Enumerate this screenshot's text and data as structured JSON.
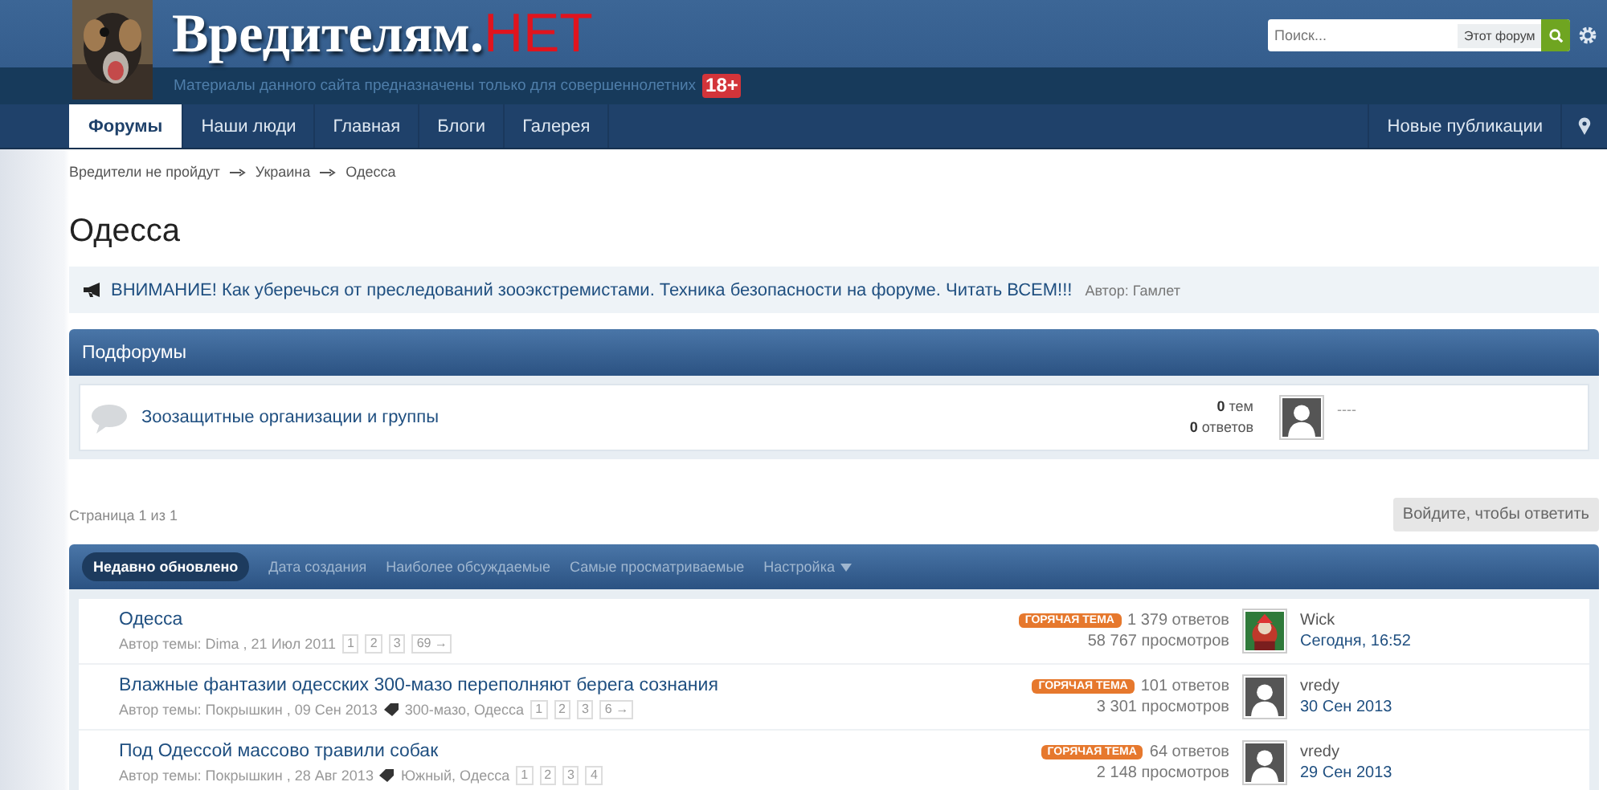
{
  "header": {
    "logo_main": "Вредителям.",
    "logo_accent": "НЕТ",
    "tagline": "Материалы данного сайта предназначены только для совершеннолетних",
    "age_badge": "18+",
    "search": {
      "placeholder": "Поиск...",
      "scope": "Этот форум"
    }
  },
  "nav": {
    "tabs": [
      {
        "label": "Форумы",
        "selected": true
      },
      {
        "label": "Наши люди",
        "selected": false
      },
      {
        "label": "Главная",
        "selected": false
      },
      {
        "label": "Блоги",
        "selected": false
      },
      {
        "label": "Галерея",
        "selected": false
      }
    ],
    "right_link": "Новые публикации"
  },
  "breadcrumbs": [
    "Вредители не пройдут",
    "Украина",
    "Одесса"
  ],
  "page_title": "Одесса",
  "announcement": {
    "text": "ВНИМАНИЕ! Как уберечься от преследований зооэкстремистами. Техника безопасности на форуме. Читать ВСЕМ!!!",
    "author": "Автор: Гамлет"
  },
  "subforums": {
    "title": "Подфорумы",
    "items": [
      {
        "name": "Зоозащитные организации и группы",
        "topics": "0",
        "topics_label": "тем",
        "replies": "0",
        "replies_label": "ответов",
        "last_post": "----"
      }
    ]
  },
  "pagination": "Страница 1 из 1",
  "reply_button": "Войдите, чтобы ответить",
  "filters": [
    {
      "label": "Недавно обновлено",
      "selected": true,
      "kind": "tab"
    },
    {
      "label": "Дата создания",
      "selected": false,
      "kind": "tab"
    },
    {
      "label": "Наиболее обсуждаемые",
      "selected": false,
      "kind": "tab"
    },
    {
      "label": "Самые просматриваемые",
      "selected": false,
      "kind": "tab"
    },
    {
      "label": "Настройка",
      "selected": false,
      "kind": "dropdown"
    }
  ],
  "topics": [
    {
      "title": "Одесса",
      "meta": "Автор темы: Dima , 21 Июл 2011",
      "pages": [
        "1",
        "2",
        "3",
        "69 →"
      ],
      "badge": "ГОРЯЧАЯ ТЕМА",
      "replies": "1 379 ответов",
      "views": "58 767 просмотров",
      "last_user": "Wick",
      "last_date": "Сегодня, 16:52",
      "avatar": {
        "kind": "picture"
      }
    },
    {
      "title": "Влажные фантазии одесских 300-мазо переполняют берега сознания",
      "meta": "Автор темы: Покрышкин , 09 Сен 2013",
      "tags": "300-мазо, Одесса",
      "pages": [
        "1",
        "2",
        "3",
        "6 →"
      ],
      "badge": "ГОРЯЧАЯ ТЕМА",
      "replies": "101 ответов",
      "views": "3 301 просмотров",
      "last_user": "vredy",
      "last_date": "30 Сен 2013",
      "avatar": {
        "kind": "silhouette"
      }
    },
    {
      "title": "Под Одессой массово травили собак",
      "meta": "Автор темы: Покрышкин , 28 Авг 2013",
      "tags": "Южный, Одесса",
      "pages": [
        "1",
        "2",
        "3",
        "4"
      ],
      "badge": "ГОРЯЧАЯ ТЕМА",
      "replies": "64 ответов",
      "views": "2 148 просмотров",
      "last_user": "vredy",
      "last_date": "29 Сен 2013",
      "avatar": {
        "kind": "silhouette"
      }
    }
  ]
}
